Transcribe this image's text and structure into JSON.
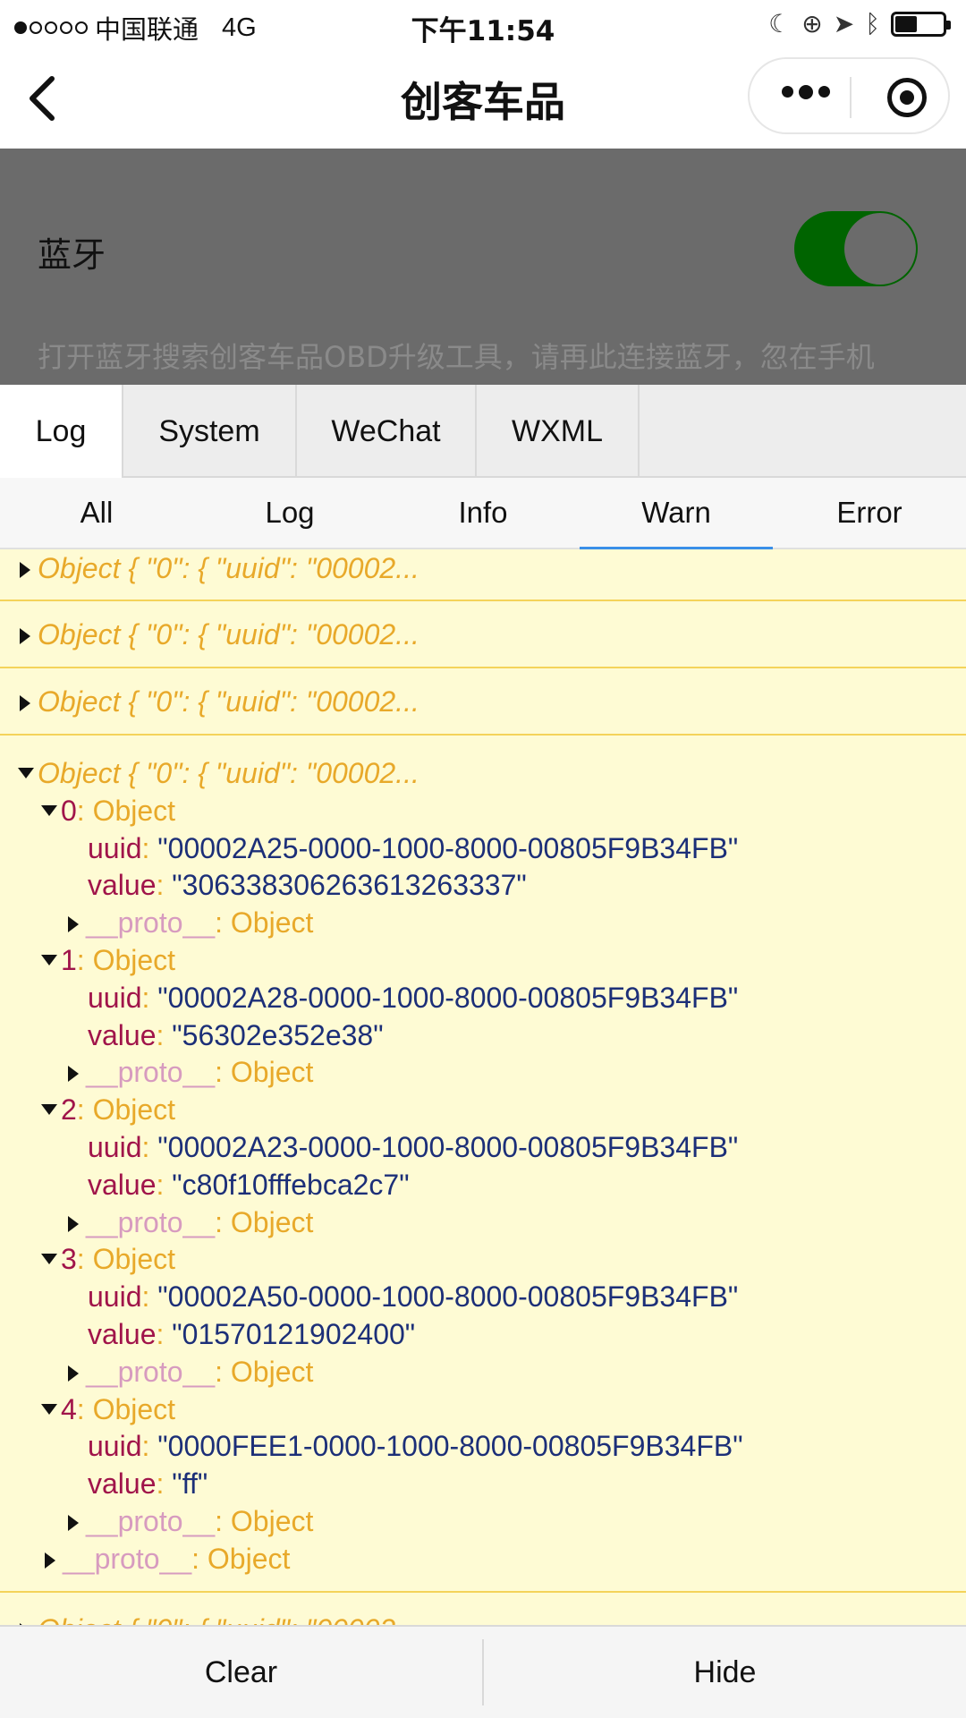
{
  "status": {
    "carrier": "中国联通",
    "network": "4G",
    "time": "下午11:54"
  },
  "nav": {
    "title": "创客车品"
  },
  "page": {
    "bluetooth_label": "蓝牙",
    "bluetooth_on": true,
    "hint": "打开蓝牙搜索创客车品OBD升级工具，请再此连接蓝牙，忽在手机"
  },
  "console": {
    "tabs": [
      "Log",
      "System",
      "WeChat",
      "WXML"
    ],
    "active_tab": "Log",
    "filters": [
      "All",
      "Log",
      "Info",
      "Warn",
      "Error"
    ],
    "active_filter": "Warn",
    "collapsed_summary": "Object { \"0\": { \"uuid\": \"00002...",
    "items": [
      {
        "index": "0",
        "type": "Object",
        "uuid": "\"00002A25-0000-1000-8000-00805F9B34FB\"",
        "value": "\"306338306263613263337\""
      },
      {
        "index": "1",
        "type": "Object",
        "uuid": "\"00002A28-0000-1000-8000-00805F9B34FB\"",
        "value": "\"56302e352e38\""
      },
      {
        "index": "2",
        "type": "Object",
        "uuid": "\"00002A23-0000-1000-8000-00805F9B34FB\"",
        "value": "\"c80f10fffebca2c7\""
      },
      {
        "index": "3",
        "type": "Object",
        "uuid": "\"00002A50-0000-1000-8000-00805F9B34FB\"",
        "value": "\"01570121902400\""
      },
      {
        "index": "4",
        "type": "Object",
        "uuid": "\"0000FEE1-0000-1000-8000-00805F9B34FB\"",
        "value": "\"ff\""
      }
    ],
    "uuid_key": "uuid",
    "value_key": "value",
    "proto_key": "__proto__",
    "proto_type": "Object",
    "buttons": {
      "clear": "Clear",
      "hide": "Hide"
    }
  }
}
